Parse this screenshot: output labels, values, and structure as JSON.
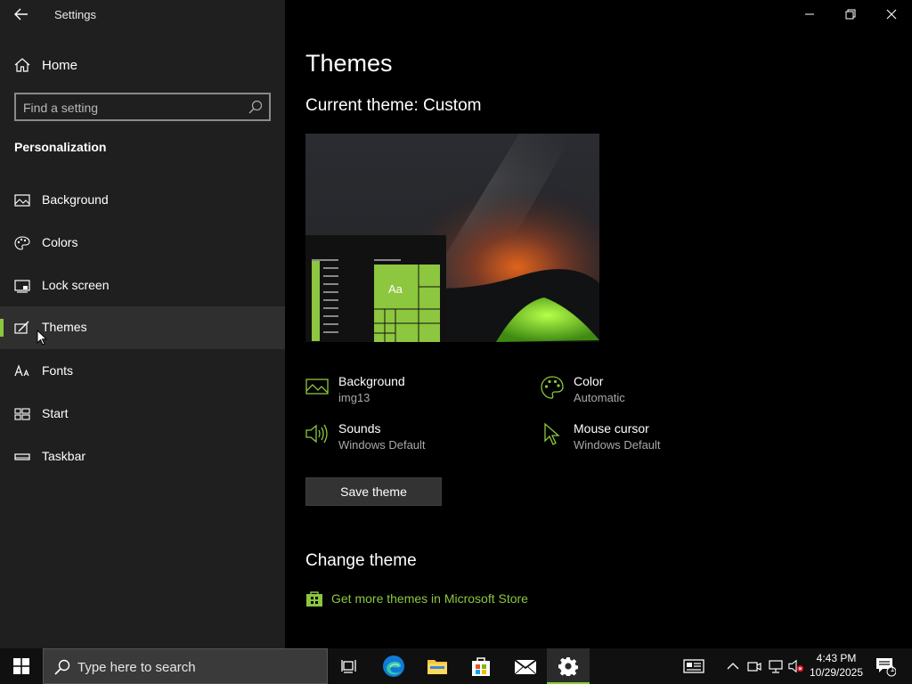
{
  "window": {
    "title": "Settings",
    "controls": [
      "minimize",
      "restore",
      "close"
    ]
  },
  "sidebar": {
    "home_label": "Home",
    "search_placeholder": "Find a setting",
    "section_title": "Personalization",
    "items": [
      {
        "label": "Background",
        "icon": "picture-icon"
      },
      {
        "label": "Colors",
        "icon": "palette-icon"
      },
      {
        "label": "Lock screen",
        "icon": "lock-screen-icon"
      },
      {
        "label": "Themes",
        "icon": "themes-icon",
        "selected": true
      },
      {
        "label": "Fonts",
        "icon": "fonts-icon"
      },
      {
        "label": "Start",
        "icon": "start-icon"
      },
      {
        "label": "Taskbar",
        "icon": "taskbar-icon"
      }
    ]
  },
  "main": {
    "title": "Themes",
    "current_theme": "Current theme: Custom",
    "preview_tile_text": "Aa",
    "settings": {
      "background": {
        "name": "Background",
        "value": "img13"
      },
      "color": {
        "name": "Color",
        "value": "Automatic"
      },
      "sounds": {
        "name": "Sounds",
        "value": "Windows Default"
      },
      "mouse_cursor": {
        "name": "Mouse cursor",
        "value": "Windows Default"
      }
    },
    "save_button": "Save theme",
    "change_theme_heading": "Change theme",
    "store_link": "Get more themes in Microsoft Store"
  },
  "taskbar": {
    "search_placeholder": "Type here to search",
    "time": "4:43 PM",
    "date": "10/29/2025",
    "notification_count": "1",
    "pinned_apps": [
      "task-view",
      "edge",
      "file-explorer",
      "microsoft-store",
      "mail",
      "settings"
    ]
  },
  "colors": {
    "accent": "#8dc63f",
    "sidebar_bg": "#1f1f1f",
    "main_bg": "#000000",
    "selected_bg": "#2f2f2f"
  }
}
